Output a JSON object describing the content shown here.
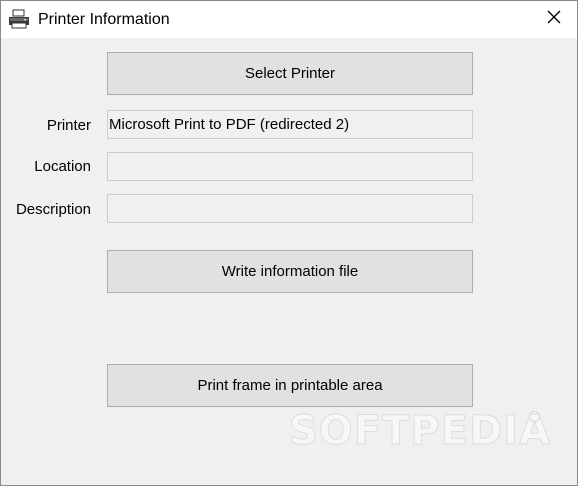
{
  "window": {
    "title": "Printer Information",
    "icon": "printer-icon",
    "close_icon": "close-icon"
  },
  "buttons": {
    "select_printer": "Select Printer",
    "write_info": "Write information file",
    "print_frame": "Print frame in printable area"
  },
  "fields": {
    "printer": {
      "label": "Printer",
      "value": "Microsoft Print to PDF (redirected 2)"
    },
    "location": {
      "label": "Location",
      "value": ""
    },
    "description": {
      "label": "Description",
      "value": ""
    }
  },
  "watermark": {
    "text": "SOFTPEDIA"
  },
  "colors": {
    "dialog_bg": "#f0f0f0",
    "titlebar_bg": "#ffffff",
    "button_bg": "#e1e1e1",
    "button_border": "#adadad"
  }
}
